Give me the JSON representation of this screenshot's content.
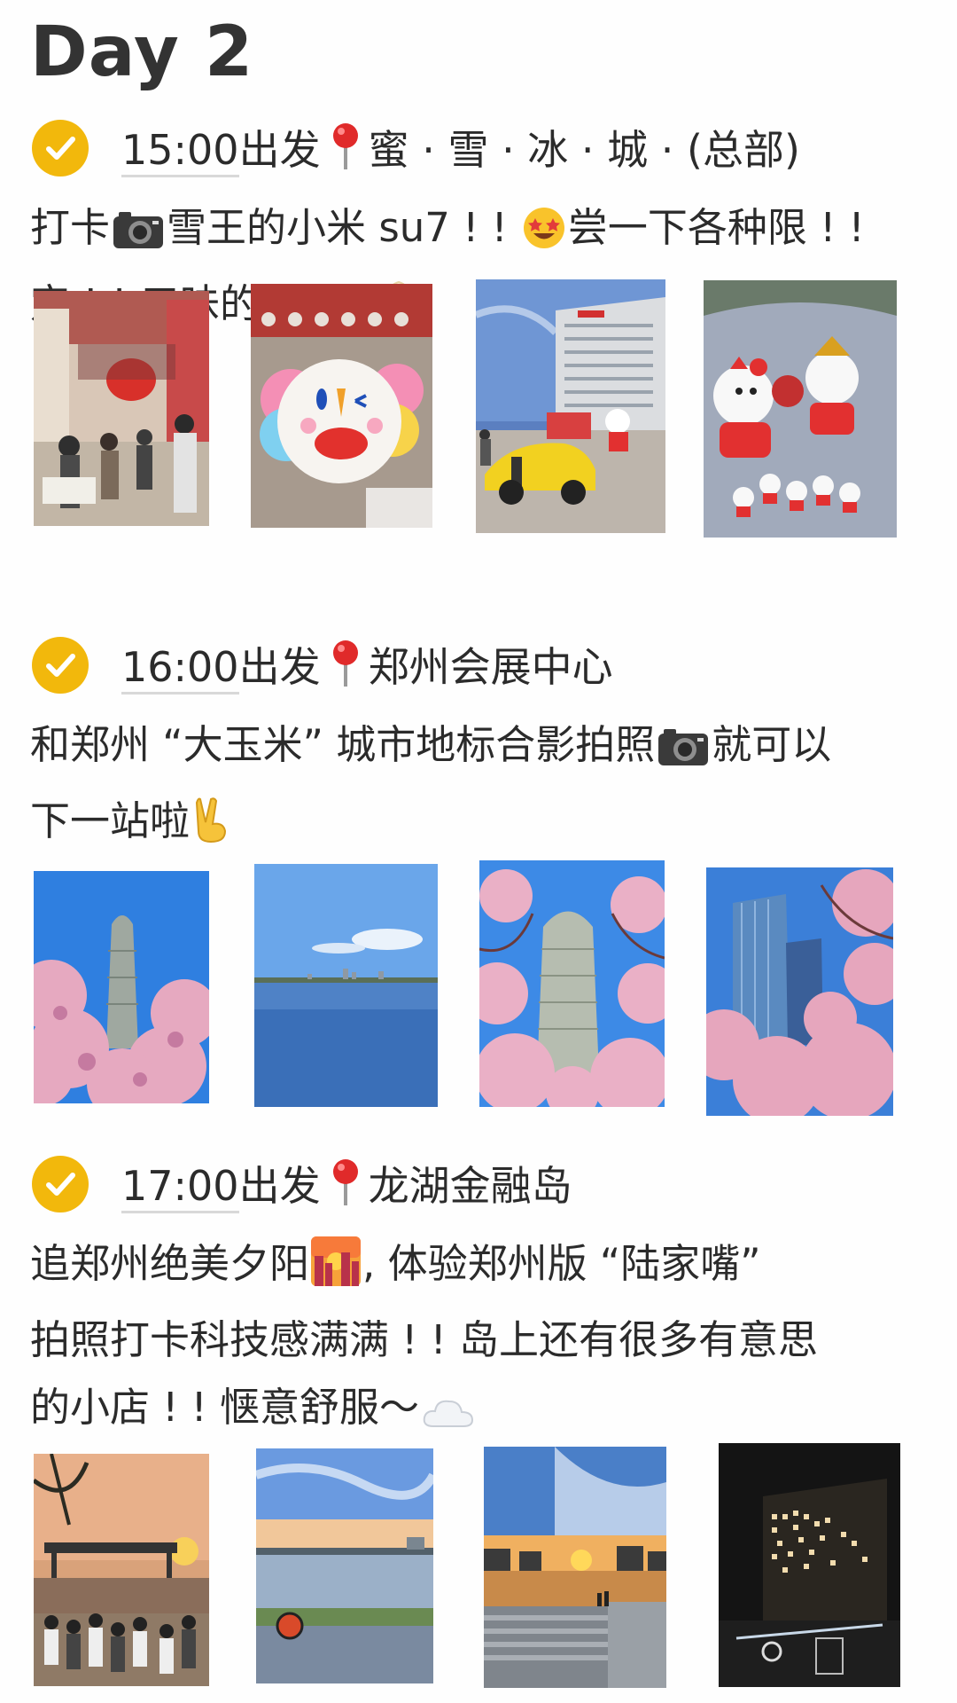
{
  "title": "Day 2",
  "sections": [
    {
      "time": "15:00",
      "depart": "出发",
      "place": "蜜 · 雪 · 冰 · 城 · (总部)",
      "line1_a": "打卡",
      "line1_b": "雪王的小米 su7 ! !",
      "line1_c": "尝一下各种限 ! !",
      "line2": "定 ! !  口味的冰淇淋",
      "photos": [
        "store-interior",
        "plush-toy",
        "yellow-car-building",
        "snowman-figures"
      ]
    },
    {
      "time": "16:00",
      "depart": "出发",
      "place": "郑州会展中心",
      "line1_a": "和郑州 “大玉米” 城市地标合影拍照",
      "line1_b": "就可以",
      "line2": "下一站啦",
      "photos": [
        "tower-blossoms",
        "lake-view",
        "tower-blossoms-2",
        "glass-building-blossoms"
      ]
    },
    {
      "time": "17:00",
      "depart": "出发",
      "place": "龙湖金融岛",
      "line1_a": "追郑州绝美夕阳",
      "line1_b": ", 体验郑州版 “陆家嘴”",
      "line2": "拍照打卡科技感满满 ! !  岛上还有很多有意思",
      "line3": "的小店 ! !  惬意舒服～",
      "photos": [
        "sunset-crowd",
        "lake-sunset",
        "sunset-steps",
        "night-led-building"
      ]
    }
  ],
  "colors": {
    "check": "#f2b80c",
    "pin": "#e02a2a",
    "text": "#2b2b2b"
  }
}
